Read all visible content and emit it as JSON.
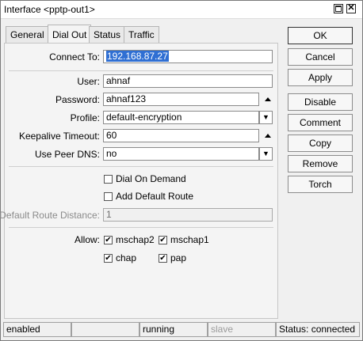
{
  "window": {
    "title": "Interface <pptp-out1>"
  },
  "tabs": [
    {
      "label": "General",
      "active": false
    },
    {
      "label": "Dial Out",
      "active": true
    },
    {
      "label": "Status",
      "active": false
    },
    {
      "label": "Traffic",
      "active": false
    }
  ],
  "form": {
    "connect_to": {
      "label": "Connect To:",
      "value": "192.168.87.27"
    },
    "user": {
      "label": "User:",
      "value": "ahnaf"
    },
    "password": {
      "label": "Password:",
      "value": "ahnaf123"
    },
    "profile": {
      "label": "Profile:",
      "value": "default-encryption"
    },
    "keepalive_timeout": {
      "label": "Keepalive Timeout:",
      "value": "60"
    },
    "use_peer_dns": {
      "label": "Use Peer DNS:",
      "value": "no"
    },
    "dial_on_demand": {
      "label": "Dial On Demand",
      "checked": false
    },
    "add_default_route": {
      "label": "Add Default Route",
      "checked": false
    },
    "default_route_distance": {
      "label": "Default Route Distance:",
      "value": "1"
    },
    "allow": {
      "label": "Allow:",
      "options": [
        {
          "label": "mschap2",
          "checked": true
        },
        {
          "label": "mschap1",
          "checked": true
        },
        {
          "label": "chap",
          "checked": true
        },
        {
          "label": "pap",
          "checked": true
        }
      ]
    }
  },
  "buttons": {
    "ok": "OK",
    "cancel": "Cancel",
    "apply": "Apply",
    "disable": "Disable",
    "comment": "Comment",
    "copy": "Copy",
    "remove": "Remove",
    "torch": "Torch"
  },
  "statusbar": {
    "state": "enabled",
    "blank": "",
    "running": "running",
    "slave": "slave",
    "status": "Status: connected"
  }
}
